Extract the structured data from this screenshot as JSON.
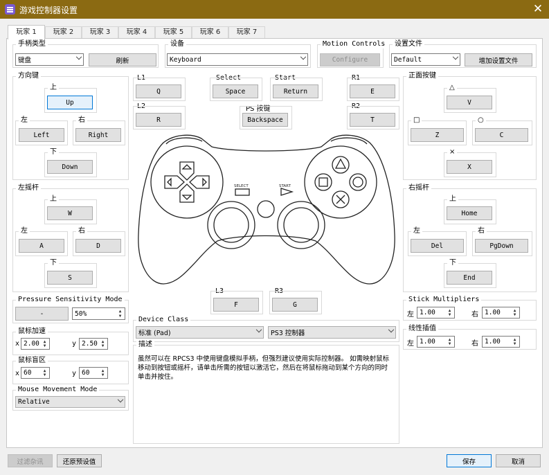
{
  "window": {
    "title": "游戏控制器设置"
  },
  "tabs": [
    "玩家 1",
    "玩家 2",
    "玩家 3",
    "玩家 4",
    "玩家 5",
    "玩家 6",
    "玩家 7"
  ],
  "handler": {
    "title": "手柄类型",
    "value": "键盘",
    "refresh": "刷新"
  },
  "device": {
    "title": "设备",
    "value": "Keyboard"
  },
  "motion": {
    "title": "Motion Controls",
    "button": "Configure"
  },
  "profile": {
    "title": "设置文件",
    "value": "Default",
    "add": "增加设置文件"
  },
  "dpad": {
    "title": "方向键",
    "up_label": "上",
    "up": "Up",
    "left_label": "左",
    "left": "Left",
    "right_label": "右",
    "right": "Right",
    "down_label": "下",
    "down": "Down"
  },
  "lstick": {
    "title": "左摇杆",
    "up_label": "上",
    "up": "W",
    "left_label": "左",
    "left": "A",
    "right_label": "右",
    "right": "D",
    "down_label": "下",
    "down": "S"
  },
  "pressure": {
    "title": "Pressure Sensitivity Mode",
    "button": "-",
    "value": "50%"
  },
  "mouse_accel": {
    "title": "鼠标加速",
    "x_label": "x",
    "x": "2.00",
    "y_label": "y",
    "y": "2.50"
  },
  "deadzone": {
    "title": "鼠标盲区",
    "x_label": "x",
    "x": "60",
    "y_label": "y",
    "y": "60"
  },
  "mouse_move": {
    "title": "Mouse Movement Mode",
    "value": "Relative"
  },
  "shoulder": {
    "l1_label": "L1",
    "l1": "Q",
    "l2_label": "L2",
    "l2": "R",
    "r1_label": "R1",
    "r1": "E",
    "r2_label": "R2",
    "r2": "T"
  },
  "center": {
    "select_label": "Select",
    "select": "Space",
    "start_label": "Start",
    "start": "Return",
    "ps_label": "PS 按键",
    "ps": "Backspace"
  },
  "pad_labels": {
    "select": "SELECT",
    "start": "START"
  },
  "sticks_click": {
    "l3_label": "L3",
    "l3": "F",
    "r3_label": "R3",
    "r3": "G"
  },
  "face": {
    "title": "正面按键",
    "triangle_sym": "△",
    "triangle": "V",
    "square_sym": "□",
    "square": "Z",
    "circle_sym": "○",
    "circle": "C",
    "cross_sym": "×",
    "cross": "X"
  },
  "rstick": {
    "title": "右摇杆",
    "up_label": "上",
    "up": "Home",
    "left_label": "左",
    "left": "Del",
    "right_label": "右",
    "right": "PgDown",
    "down_label": "下",
    "down": "End"
  },
  "device_class": {
    "title": "Device Class",
    "value": "标准 (Pad)",
    "value2": "PS3 控制器"
  },
  "description": {
    "title": "描述",
    "text": "虽然可以在 RPCS3 中使用键盘模拟手柄，但强烈建议使用实际控制器。 如需映射鼠标移动到按钮或摇杆，请单击所需的按钮以激活它，然后在将鼠标拖动到某个方向的同时单击并按住。"
  },
  "stick_mult": {
    "title": "Stick Multipliers",
    "left_label": "左",
    "left": "1.00",
    "right_label": "右",
    "right": "1.00"
  },
  "lerp": {
    "title": "线性插值",
    "left_label": "左",
    "left": "1.00",
    "right_label": "右",
    "right": "1.00"
  },
  "footer": {
    "filter": "过滤杂讯",
    "restore": "还原预设值",
    "save": "保存",
    "cancel": "取消"
  }
}
